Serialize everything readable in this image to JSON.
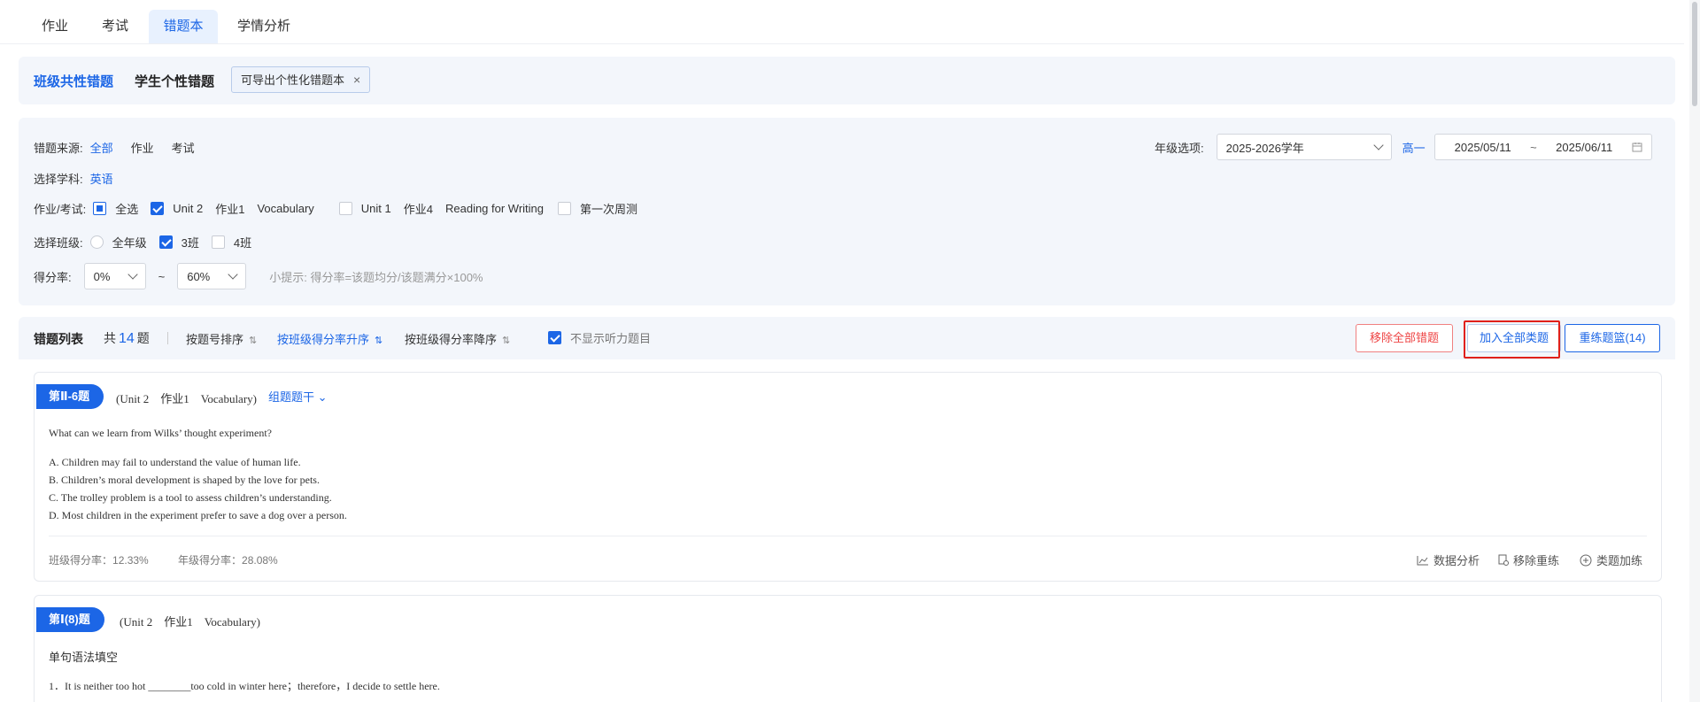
{
  "top_tabs": [
    {
      "label": "作业",
      "active": false
    },
    {
      "label": "考试",
      "active": false
    },
    {
      "label": "错题本",
      "active": true
    },
    {
      "label": "学情分析",
      "active": false
    }
  ],
  "sub_tabs": {
    "class_common": "班级共性错题",
    "student_personal": "学生个性错题",
    "chip_label": "可导出个性化错题本",
    "chip_close": "×"
  },
  "filters": {
    "source_label": "错题来源:",
    "source_options": [
      "全部",
      "作业",
      "考试"
    ],
    "subject_label": "选择学科:",
    "subject_value": "英语",
    "work_label": "作业/考试:",
    "work_select_all": "全选",
    "work_items": [
      {
        "unit": "Unit 2",
        "name": "作业1",
        "topic": "Vocabulary",
        "checked": true
      },
      {
        "unit": "Unit 1",
        "name": "作业4",
        "topic": "Reading for Writing",
        "checked": false
      },
      {
        "unit": "",
        "name": "第一次周测",
        "topic": "",
        "checked": false
      }
    ],
    "class_label": "选择班级:",
    "class_all": "全年级",
    "class_items": [
      {
        "label": "3班",
        "checked": true
      },
      {
        "label": "4班",
        "checked": false
      }
    ],
    "score_label": "得分率:",
    "score_from": "0%",
    "score_tilde": "~",
    "score_to": "60%",
    "hint": "小提示: 得分率=该题均分/该题满分×100%",
    "grade_label": "年级选项:",
    "grade_value": "2025-2026学年",
    "grade_level": "高一",
    "date_from": "2025/05/11",
    "date_sep": "~",
    "date_to": "2025/06/11"
  },
  "list": {
    "title": "错题列表",
    "count_prefix": "共",
    "count": "14",
    "count_suffix": "题",
    "sort_by_number": "按题号排序",
    "sort_class_asc": "按班级得分率升序",
    "sort_class_desc": "按班级得分率降序",
    "hide_listening": "不显示听力题目",
    "btn_remove_all": "移除全部错题",
    "btn_add_all": "加入全部类题",
    "btn_retrain": "重练题篮(14)"
  },
  "questions": [
    {
      "tag": "第Ⅱ-6题",
      "meta": "(Unit 2　作业1　Vocabulary)",
      "group_label": "组题题干",
      "stem": "What can we learn from Wilks’ thought experiment?",
      "options": [
        "A. Children may fail to understand the value of human life.",
        "B. Children’s moral development is shaped by the love for pets.",
        "C. The trolley problem is a tool to assess children’s understanding.",
        "D. Most children in the experiment prefer to save a dog over a person."
      ],
      "class_rate_label": "班级得分率：",
      "class_rate": "12.33%",
      "grade_rate_label": "年级得分率：",
      "grade_rate": "28.08%",
      "actions": [
        "数据分析",
        "移除重练",
        "类题加练"
      ]
    },
    {
      "tag": "第Ⅰ(8)题",
      "meta": "(Unit 2　作业1　Vocabulary)",
      "title": "单句语法填空",
      "stem": "1．It is neither too hot ________too cold in winter here；therefore，I decide to settle here."
    }
  ],
  "colors": {
    "accent": "#1c66e6",
    "danger": "#e44444",
    "highlight_box": "#e0201a",
    "panel_bg": "#f3f6fb"
  }
}
